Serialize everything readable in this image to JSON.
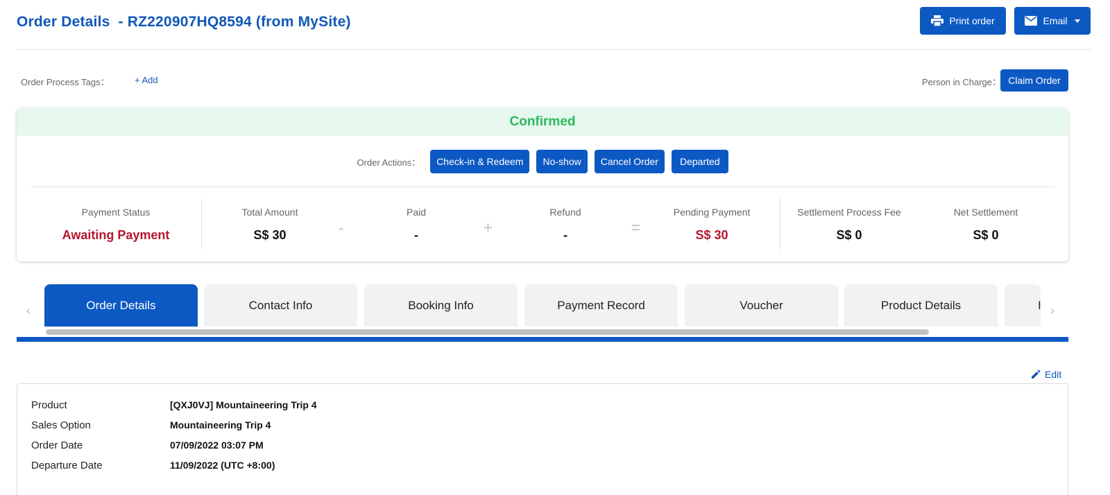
{
  "header": {
    "title": "Order Details  - RZ220907HQ8594 (from MySite)",
    "print_label": "Print order",
    "email_label": "Email"
  },
  "tags": {
    "label": "Order Process Tags：",
    "add_label": "+ Add",
    "person_label": "Person in Charge：",
    "claim_label": "Claim Order"
  },
  "status": {
    "text": "Confirmed",
    "actions_label": "Order Actions：",
    "actions": [
      "Check-in & Redeem",
      "No-show",
      "Cancel Order",
      "Departed"
    ]
  },
  "metrics": {
    "payment_status": {
      "label": "Payment Status",
      "value": "Awaiting Payment"
    },
    "total_amount": {
      "label": "Total Amount",
      "value": "S$ 30"
    },
    "paid": {
      "label": "Paid",
      "value": "-"
    },
    "refund": {
      "label": "Refund",
      "value": "-"
    },
    "pending_payment": {
      "label": "Pending Payment",
      "value": "S$ 30"
    },
    "settlement_fee": {
      "label": "Settlement Process Fee",
      "value": "S$ 0"
    },
    "net_settlement": {
      "label": "Net Settlement",
      "value": "S$ 0"
    },
    "operators": [
      "-",
      "+",
      "="
    ]
  },
  "tabs": [
    "Order Details",
    "Contact Info",
    "Booking Info",
    "Payment Record",
    "Voucher",
    "Product Details",
    "I"
  ],
  "edit_label": "Edit",
  "details": [
    {
      "label": "Product",
      "value": "[QXJ0VJ] Mountaineering Trip 4"
    },
    {
      "label": "Sales Option",
      "value": "Mountaineering Trip 4"
    },
    {
      "label": "Order Date",
      "value": "07/09/2022 03:07 PM"
    },
    {
      "label": "Departure Date",
      "value": "11/09/2022 (UTC +8:00)"
    }
  ],
  "colors": {
    "primary": "#0d59c4",
    "title": "#1057b8",
    "confirmed": "#2eb85c",
    "alert_red": "#b4162b"
  }
}
